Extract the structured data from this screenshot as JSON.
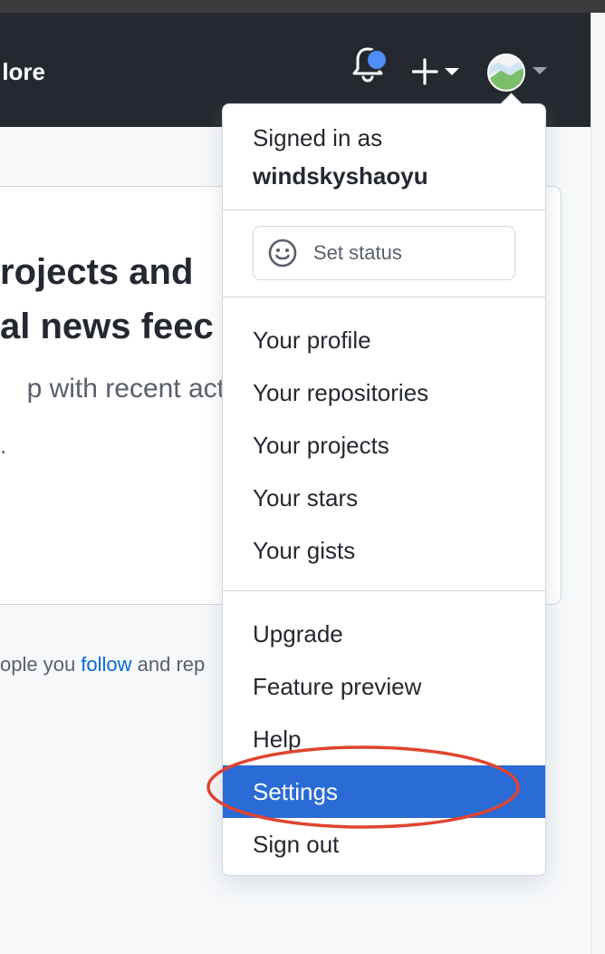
{
  "header": {
    "nav_partial": "lore",
    "notifications_icon": "bell-icon",
    "create_icon": "plus-icon",
    "avatar_icon": "avatar-image-icon",
    "bg_color": "#24292f"
  },
  "background": {
    "heading_line1": "rojects and",
    "heading_line2": "al news feec",
    "subtitle": "p with recent act",
    "dot": ".",
    "follow_prefix": "ople you ",
    "follow_link": "follow",
    "follow_suffix": " and rep"
  },
  "dropdown": {
    "signed_in_label": "Signed in as",
    "username": "windskyshaoyu",
    "set_status": {
      "label": "Set status",
      "icon": "smiley-icon"
    },
    "section1": [
      {
        "label": "Your profile"
      },
      {
        "label": "Your repositories"
      },
      {
        "label": "Your projects"
      },
      {
        "label": "Your stars"
      },
      {
        "label": "Your gists"
      }
    ],
    "section2": [
      {
        "label": "Upgrade"
      },
      {
        "label": "Feature preview"
      },
      {
        "label": "Help"
      },
      {
        "label": "Settings",
        "active": true
      },
      {
        "label": "Sign out"
      }
    ],
    "active_color": "#2a6bd6"
  },
  "annotation": {
    "color": "#e0442f",
    "target": "Settings"
  }
}
